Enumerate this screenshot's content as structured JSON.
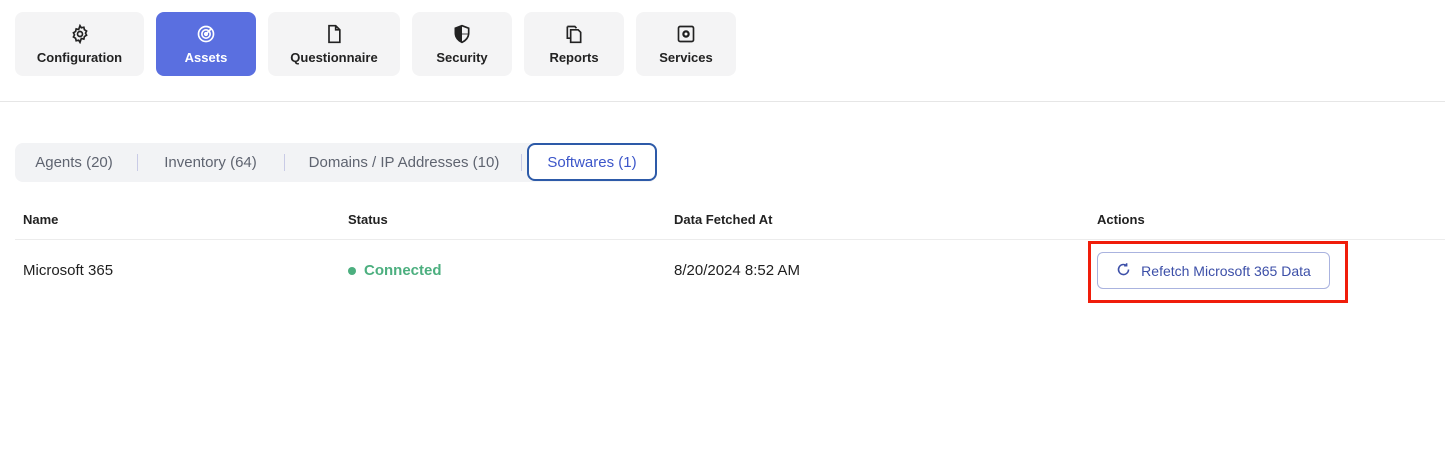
{
  "nav": {
    "items": [
      {
        "label": "Configuration",
        "icon": "gear-icon",
        "active": false
      },
      {
        "label": "Assets",
        "icon": "radar-icon",
        "active": true
      },
      {
        "label": "Questionnaire",
        "icon": "document-icon",
        "active": false
      },
      {
        "label": "Security",
        "icon": "shield-icon",
        "active": false
      },
      {
        "label": "Reports",
        "icon": "copy-icon",
        "active": false
      },
      {
        "label": "Services",
        "icon": "service-gear-icon",
        "active": false
      }
    ]
  },
  "tabs": [
    {
      "label": "Agents (20)",
      "active": false
    },
    {
      "label": "Inventory (64)",
      "active": false
    },
    {
      "label": "Domains / IP Addresses (10)",
      "active": false
    },
    {
      "label": "Softwares (1)",
      "active": true
    }
  ],
  "table": {
    "headers": {
      "name": "Name",
      "status": "Status",
      "fetched": "Data Fetched At",
      "actions": "Actions"
    },
    "rows": [
      {
        "name": "Microsoft 365",
        "status": "Connected",
        "fetched": "8/20/2024 8:52 AM",
        "action_label": "Refetch Microsoft 365 Data"
      }
    ]
  },
  "colors": {
    "accent": "#5a6fe0",
    "status_connected": "#4caf7f",
    "highlight": "#f01d0a"
  }
}
